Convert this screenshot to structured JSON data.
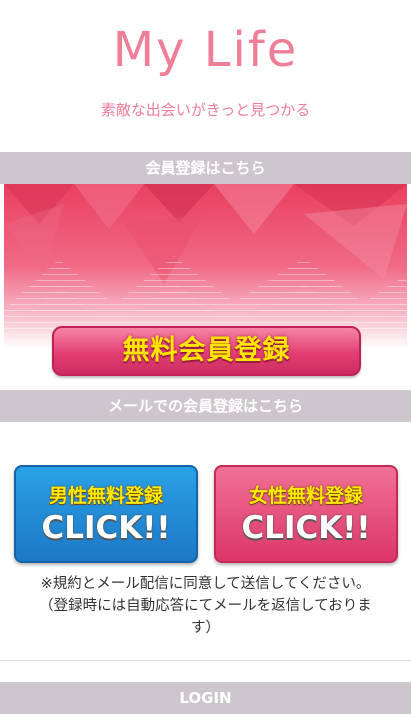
{
  "header": {
    "logo": "My Life",
    "tagline": "素敵な出会いがきっと見つかる"
  },
  "sections": {
    "member_registration": "会員登録はこちら",
    "mail_registration": "メールでの会員登録はこちら",
    "login": "LOGIN"
  },
  "banner": {
    "button_label": "無料会員登録"
  },
  "cta": {
    "male_top": "男性無料登録",
    "male_bottom": "CLICK!!",
    "female_top": "女性無料登録",
    "female_bottom": "CLICK!!"
  },
  "notice": {
    "line1": "※規約とメール配信に同意して送信してください。",
    "line2": "（登録時には自動応答にてメールを返信しておりま",
    "line3": "す）"
  },
  "colors": {
    "brand": "#ef7e99",
    "section_bar": "#cdc6cc",
    "male_button": "#1d78c8",
    "female_button": "#db3769",
    "banner_button_text": "#ffe600"
  }
}
